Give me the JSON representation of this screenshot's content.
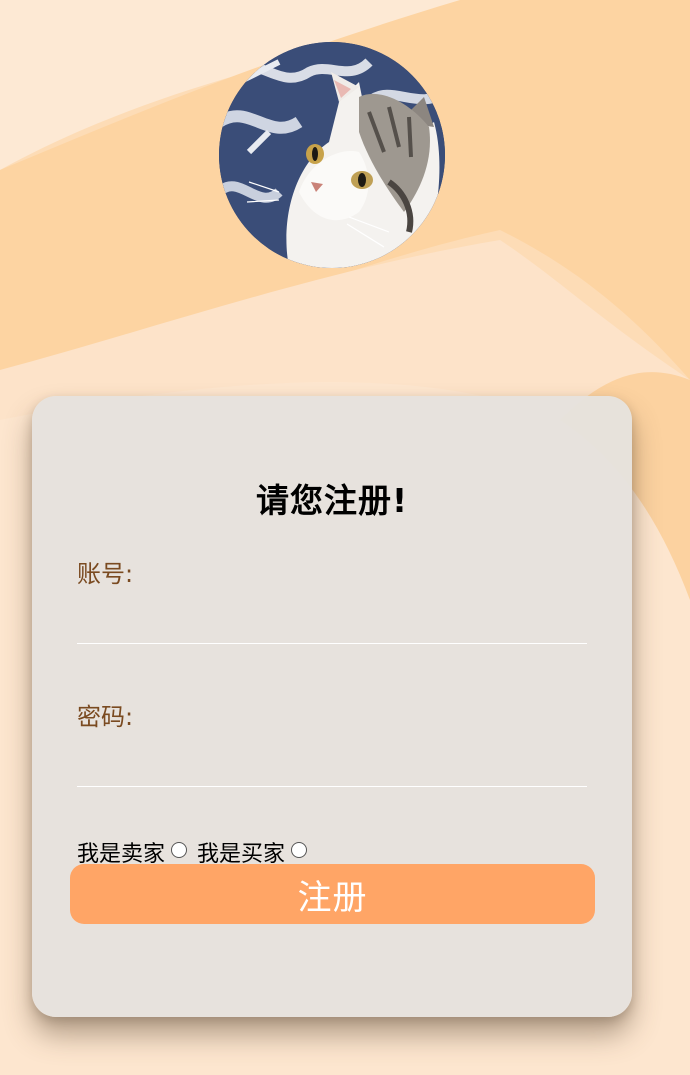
{
  "colors": {
    "background": "#fde3c6",
    "card": "#e6e2de",
    "label": "#7a4a20",
    "button": "#ffa566",
    "button_text": "#ffffff"
  },
  "avatar": {
    "icon": "cat-photo-icon"
  },
  "form": {
    "title": "请您注册!",
    "account_label": "账号:",
    "account_value": "",
    "password_label": "密码:",
    "password_value": "",
    "role_seller_label": "我是卖家",
    "role_buyer_label": "我是买家",
    "submit_label": "注册"
  }
}
